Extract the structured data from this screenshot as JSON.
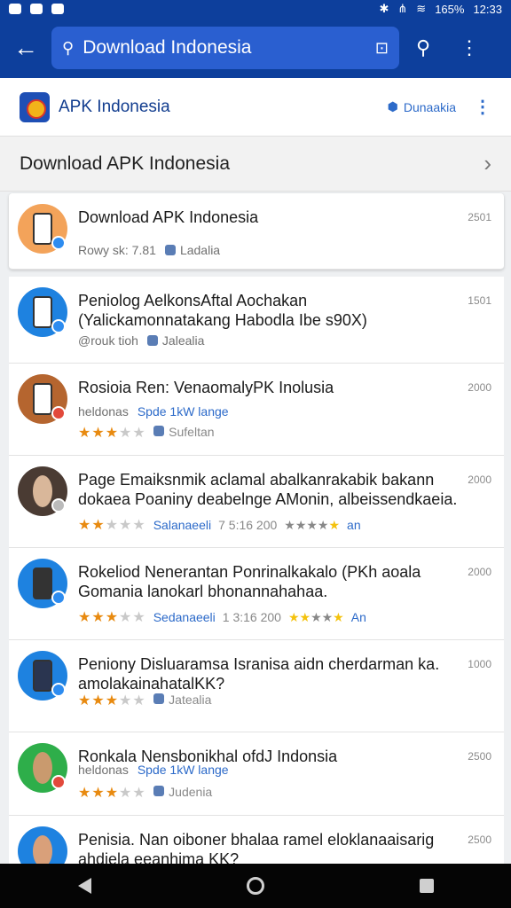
{
  "status_bar": {
    "battery": "165%",
    "time": "12:33"
  },
  "app_bar": {
    "search_query": "Download Indonesia"
  },
  "site": {
    "name": "APK Indonesia",
    "download_label": "Dunaakia"
  },
  "section": {
    "title": "Download APK  Indonesia"
  },
  "results": [
    {
      "title": "Download APK Indonesia",
      "count": "2501",
      "meta_text": "Rowy sk: 7.81",
      "meta_tag": "Ladalia",
      "thumb_color": "#f3a35a"
    },
    {
      "title": "Peniolog AelkonsAftal Aochakan (Yalickamonnatakang Habodla Ibe s90X)",
      "count": "1501",
      "meta_text": "@rouk tioh",
      "meta_tag": "Jalealia",
      "thumb_color": "#1e82e0"
    },
    {
      "title": "Rosioia Ren: VenaomalyPK Inolusia",
      "count": "2000",
      "meta_text": "heldonas",
      "meta_blue": "Spde 1kW lange",
      "rating": 3,
      "rating_tag": "Sufeltan",
      "thumb_color": "#b5652f"
    },
    {
      "title": "Page Emaiksnmik aclamal abalkanrakabik bakann dokaea Poaniny deabelnge AMonin, albeissendkaeia.",
      "count": "2000",
      "rating": 2,
      "rating_blue": "Salanaeeli",
      "rating_grey": "7 5:16 200",
      "rating_end": "an",
      "thumb_color": "#4a3b33"
    },
    {
      "title": "Rokeliod Nenerantan Ponrinalkakalo (PKh aoala Gomania lanokarl bhonannahahaa.",
      "count": "2000",
      "rating": 3,
      "rating_blue": "Sedanaeeli",
      "rating_grey": "1 3:16 200",
      "rating_end": "An",
      "thumb_color": "#1e82e0"
    },
    {
      "title": "Peniony Disluaramsa Isranisa aidn cherdarman ka. amolakainahatalKK?",
      "count": "1000",
      "rating": 3,
      "rating_tag": "Jatealia",
      "thumb_color": "#1e82e0"
    },
    {
      "title": "Ronkala Nensbonikhal ofdJ Indonsia",
      "count": "2500",
      "meta_text": "heldonas",
      "meta_blue": "Spde 1kW lange",
      "rating": 3,
      "rating_tag": "Judenia",
      "thumb_color": "#2eae4a"
    },
    {
      "title": "Penisia. Nan oiboner bhalaa ramel eloklanaaisarig ahdiela eeanhima KK?",
      "count": "2500",
      "thumb_color": "#1e82e0"
    }
  ]
}
